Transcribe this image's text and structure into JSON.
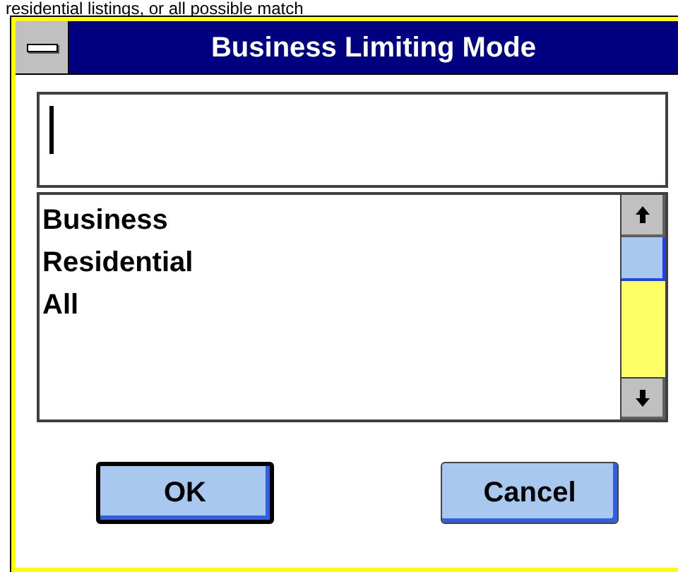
{
  "background_text": "residential listings, or all possible match",
  "window": {
    "title": "Business Limiting Mode"
  },
  "list": {
    "items": [
      {
        "label": "Business"
      },
      {
        "label": "Residential"
      },
      {
        "label": "All"
      }
    ]
  },
  "buttons": [
    {
      "label": "OK",
      "default": true
    },
    {
      "label": "Cancel",
      "default": false
    }
  ]
}
